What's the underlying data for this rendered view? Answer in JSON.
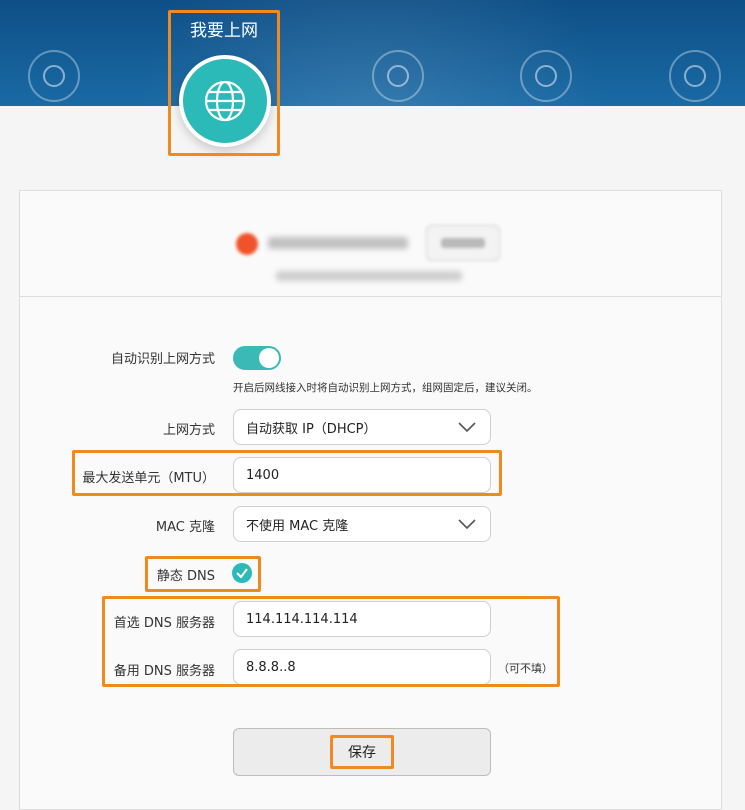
{
  "nav": {
    "active_label": "我要上网",
    "other_items": [
      "home",
      "wifi",
      "devices",
      "more"
    ]
  },
  "form": {
    "auto_detect": {
      "label": "自动识别上网方式",
      "enabled": true,
      "hint": "开启后网线接入时将自动识别上网方式，组网固定后，建议关闭。"
    },
    "connection_type": {
      "label": "上网方式",
      "value": "自动获取 IP（DHCP）"
    },
    "mtu": {
      "label": "最大发送单元（MTU）",
      "value": "1400"
    },
    "mac_clone": {
      "label": "MAC 克隆",
      "value": "不使用 MAC 克隆"
    },
    "static_dns": {
      "label": "静态 DNS",
      "checked": true
    },
    "primary_dns": {
      "label": "首选 DNS 服务器",
      "value": "114.114.114.114"
    },
    "secondary_dns": {
      "label": "备用 DNS 服务器",
      "value": "8.8.8..8",
      "note": "（可不填）"
    },
    "save_label": "保存"
  },
  "colors": {
    "accent": "#2cbab9",
    "highlight": "#f08a1d",
    "header": "#0e4f86",
    "status": "#f0522a"
  }
}
